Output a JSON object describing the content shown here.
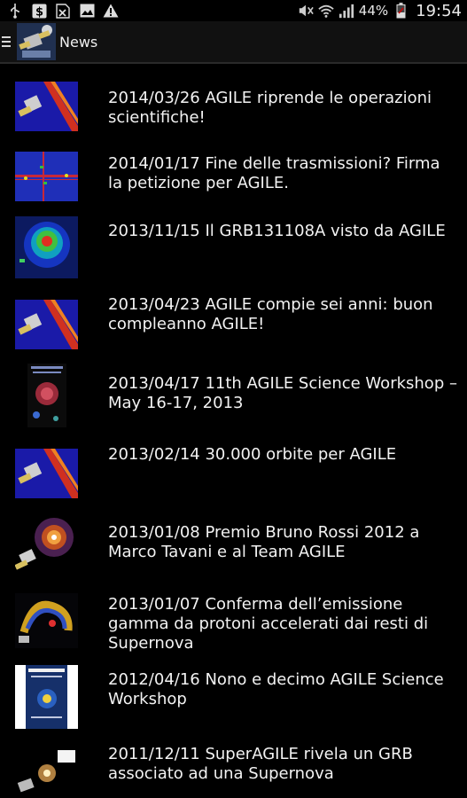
{
  "status_bar": {
    "battery": "44%",
    "time": "19:54",
    "icons": [
      "usb-icon",
      "dollar-icon",
      "excel-icon",
      "image-icon",
      "warning-icon",
      "mute-icon",
      "wifi-icon",
      "signal-icon",
      "battery-icon"
    ]
  },
  "action_bar": {
    "title": "News",
    "icons": [
      "drawer-icon",
      "app-icon"
    ]
  },
  "news": [
    {
      "title": "2014/03/26 AGILE riprende le operazioni scientifiche!",
      "thumbnail": "satellite-thumbnail"
    },
    {
      "title": "2014/01/17 Fine delle trasmissioni? Firma la petizione per AGILE.",
      "thumbnail": "sky-map-thumbnail"
    },
    {
      "title": "2013/11/15 Il GRB131108A visto da AGILE",
      "thumbnail": "grb-map-thumbnail"
    },
    {
      "title": "2013/04/23 AGILE compie sei anni: buon compleanno AGILE!",
      "thumbnail": "satellite-thumbnail"
    },
    {
      "title": "2013/04/17 11th AGILE Science Workshop – May 16-17, 2013",
      "thumbnail": "workshop-poster-thumbnail"
    },
    {
      "title": "2013/02/14 30.000 orbite per AGILE",
      "thumbnail": "satellite-thumbnail"
    },
    {
      "title": "2013/01/08 Premio Bruno Rossi 2012 a Marco Tavani e al Team AGILE",
      "thumbnail": "nebula-satellite-thumbnail"
    },
    {
      "title": "2013/01/07 Conferma dell’emissione gamma da protoni accelerati dai resti di Supernova",
      "thumbnail": "supernova-remnant-thumbnail"
    },
    {
      "title": "2012/04/16 Nono e decimo AGILE Science Workshop",
      "thumbnail": "workshop-poster-thumbnail"
    },
    {
      "title": "2011/12/11 SuperAGILE rivela un GRB associato ad una Supernova",
      "thumbnail": "grb-supernova-thumbnail"
    }
  ]
}
